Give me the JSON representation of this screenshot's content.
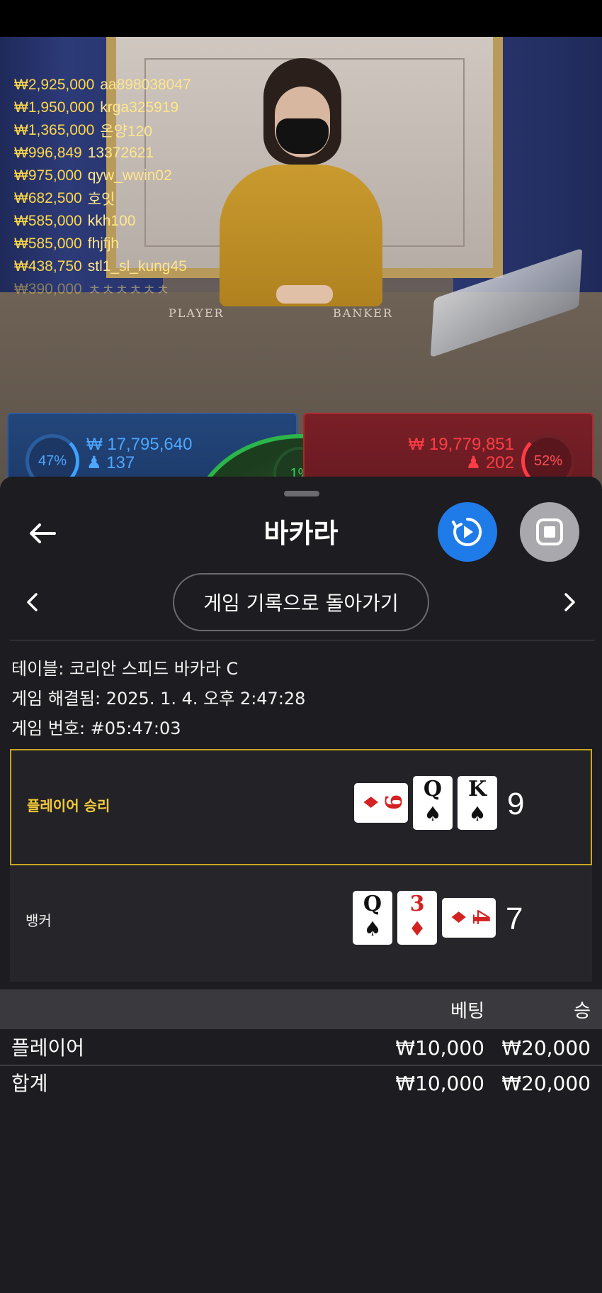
{
  "header": {
    "title": "바카라"
  },
  "live_bets": [
    {
      "amount": "₩2,925,000",
      "user": "aa898038047"
    },
    {
      "amount": "₩1,950,000",
      "user": "krga325919"
    },
    {
      "amount": "₩1,365,000",
      "user": "온양120"
    },
    {
      "amount": "₩996,849",
      "user": "13372621"
    },
    {
      "amount": "₩975,000",
      "user": "qyw_wwin02"
    },
    {
      "amount": "₩682,500",
      "user": "호잇"
    },
    {
      "amount": "₩585,000",
      "user": "kkh100"
    },
    {
      "amount": "₩585,000",
      "user": "fhjfjh"
    },
    {
      "amount": "₩438,750",
      "user": "stl1_sl_kung45"
    },
    {
      "amount": "₩390,000",
      "user": "ㅊㅊㅊㅊㅊㅊ"
    }
  ],
  "table_labels": {
    "player": "PLAYER",
    "banker": "BANKER"
  },
  "totals": {
    "player": {
      "percent": "47%",
      "amount": "₩ 17,795,640",
      "count": "137"
    },
    "tie": {
      "percent": "1%"
    },
    "banker": {
      "percent": "52%",
      "amount": "₩ 19,779,851",
      "count": "202"
    }
  },
  "nav": {
    "return_label": "게임 기록으로 돌아가기"
  },
  "info": {
    "table": "테이블: 코리안 스피드 바카라 C",
    "resolved": "게임 해결됨: 2025. 1. 4. 오후 2:47:28",
    "number": "게임 번호: #05:47:03"
  },
  "results": {
    "player": {
      "label": "플레이어 승리",
      "score": "9",
      "cards": [
        {
          "rank": "9",
          "suit": "♦",
          "color": "#d42121",
          "orientation": "side"
        },
        {
          "rank": "Q",
          "suit": "♠",
          "color": "#111111",
          "orientation": "up"
        },
        {
          "rank": "K",
          "suit": "♠",
          "color": "#111111",
          "orientation": "up"
        }
      ]
    },
    "banker": {
      "label": "뱅커",
      "score": "7",
      "cards": [
        {
          "rank": "Q",
          "suit": "♠",
          "color": "#111111",
          "orientation": "up"
        },
        {
          "rank": "3",
          "suit": "♦",
          "color": "#d42121",
          "orientation": "up"
        },
        {
          "rank": "4",
          "suit": "♦",
          "color": "#d42121",
          "orientation": "side"
        }
      ]
    }
  },
  "bet_table": {
    "headers": {
      "bet": "베팅",
      "win": "승"
    },
    "rows": [
      {
        "name": "플레이어",
        "bet": "₩10,000",
        "win": "₩20,000"
      },
      {
        "name": "합계",
        "bet": "₩10,000",
        "win": "₩20,000"
      }
    ]
  },
  "colors": {
    "accent_blue": "#1f7be8",
    "win_gold": "#c9a622",
    "player_blue": "#4ea6ff",
    "banker_red": "#ff3d46",
    "tie_green": "#36d05a"
  }
}
